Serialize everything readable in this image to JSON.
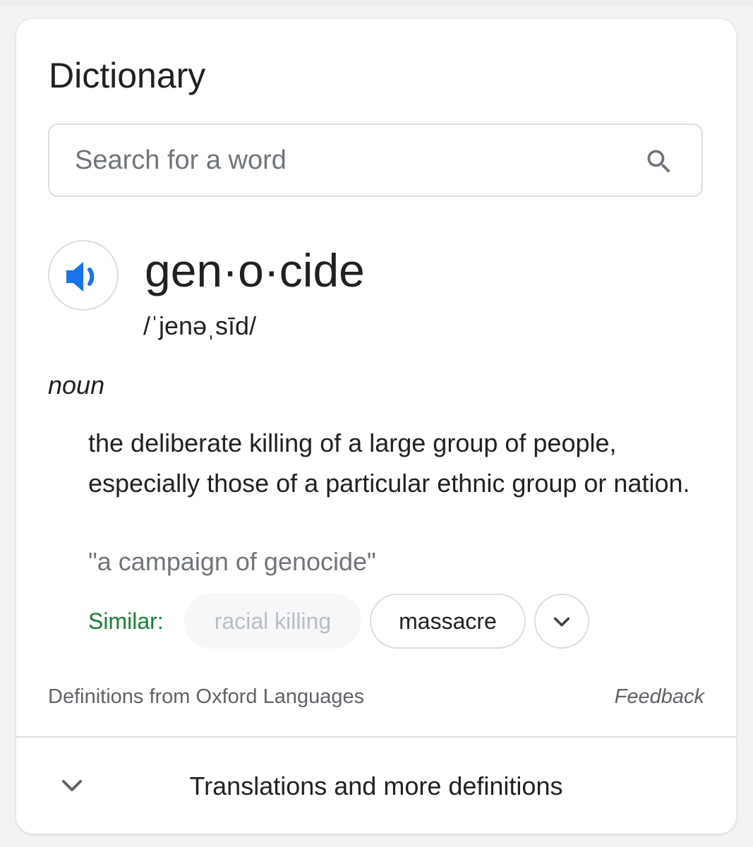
{
  "card": {
    "title": "Dictionary"
  },
  "search": {
    "placeholder": "Search for a word",
    "value": ""
  },
  "entry": {
    "headword": "gen·o·cide",
    "pronunciation": "/ˈjenəˌsīd/",
    "part_of_speech": "noun",
    "definition": "the deliberate killing of a large group of people, especially those of a particular ethnic group or nation.",
    "example": "\"a campaign of genocide\"",
    "similar_label": "Similar:",
    "similar_words": [
      "racial killing",
      "massacre"
    ]
  },
  "footer": {
    "source": "Definitions from Oxford Languages",
    "feedback": "Feedback"
  },
  "expander": {
    "label": "Translations and more definitions"
  },
  "icons": {
    "search": "search-icon",
    "speaker": "speaker-icon",
    "expand_similar": "chevron-down-icon",
    "expand_more": "chevron-down-icon"
  },
  "colors": {
    "accent_blue": "#1a73e8",
    "similar_green": "#188038",
    "text_primary": "#202124",
    "text_secondary": "#70757a",
    "border": "#dadce0"
  }
}
